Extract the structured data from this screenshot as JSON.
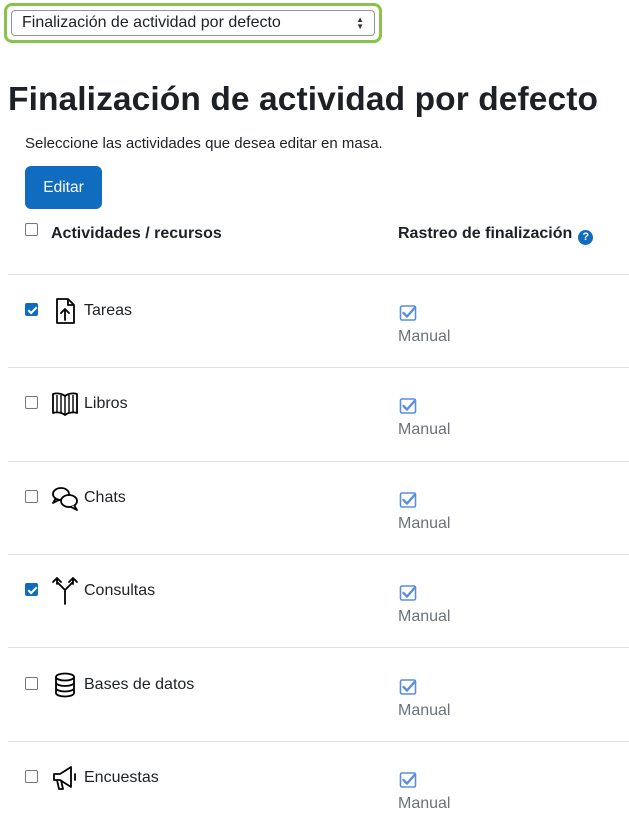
{
  "header": {
    "select_value": "Finalización de actividad por defecto",
    "title": "Finalización de actividad por defecto",
    "intro": "Seleccione las actividades que desea editar en masa.",
    "edit_button": "Editar"
  },
  "table": {
    "col_activities": "Actividades / recursos",
    "col_tracking": "Rastreo de finalización",
    "select_all_checked": false,
    "rows": [
      {
        "label": "Tareas",
        "icon": "assignment-icon",
        "checked": true,
        "tracking": "Manual"
      },
      {
        "label": "Libros",
        "icon": "book-icon",
        "checked": false,
        "tracking": "Manual"
      },
      {
        "label": "Chats",
        "icon": "chat-icon",
        "checked": false,
        "tracking": "Manual"
      },
      {
        "label": "Consultas",
        "icon": "choice-icon",
        "checked": true,
        "tracking": "Manual"
      },
      {
        "label": "Bases de datos",
        "icon": "database-icon",
        "checked": false,
        "tracking": "Manual"
      },
      {
        "label": "Encuestas",
        "icon": "feedback-icon",
        "checked": false,
        "tracking": "Manual"
      }
    ]
  },
  "colors": {
    "accent": "#0f6cbf",
    "highlight_border": "#8bc34a",
    "completion_icon": "#5a8ee0"
  }
}
